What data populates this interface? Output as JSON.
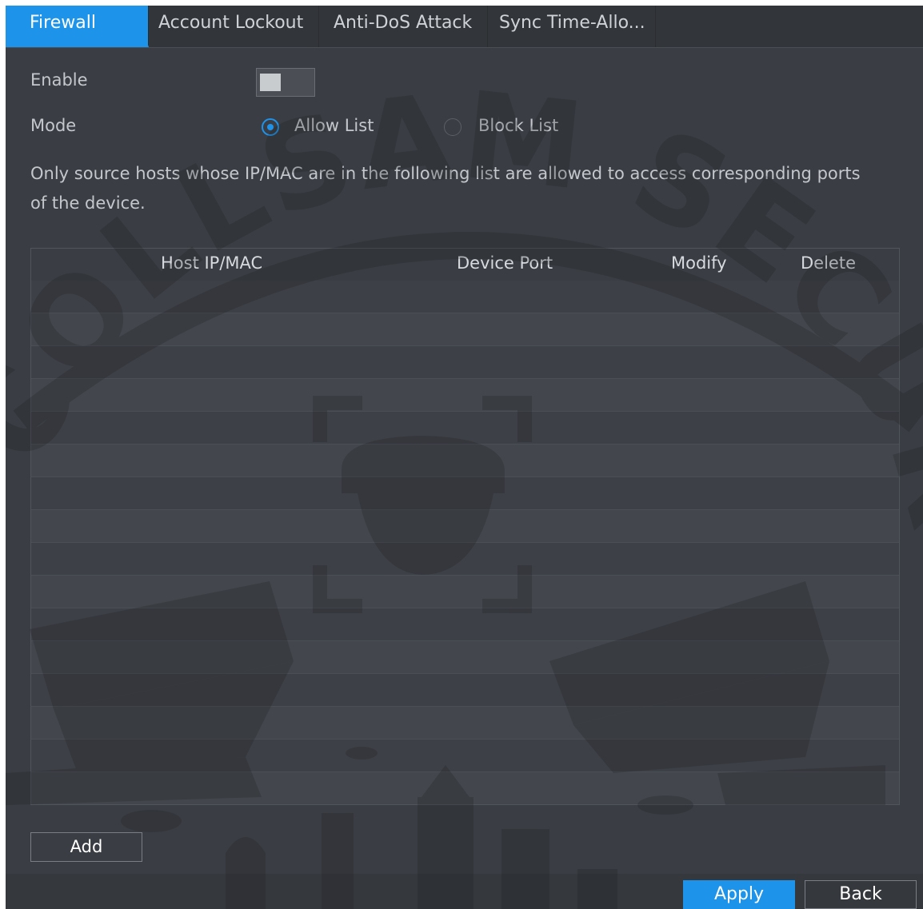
{
  "tabs": [
    {
      "label": "Firewall",
      "active": true
    },
    {
      "label": "Account Lockout",
      "active": false
    },
    {
      "label": "Anti-DoS Attack",
      "active": false
    },
    {
      "label": "Sync Time-Allo...",
      "active": false
    }
  ],
  "form": {
    "enable_label": "Enable",
    "enable_on": false,
    "mode_label": "Mode",
    "mode_options": [
      "Allow List",
      "Block List"
    ],
    "mode_selected": "Allow List",
    "description": "Only source hosts whose IP/MAC are in the following list are allowed to access corresponding ports of the device."
  },
  "table": {
    "columns": [
      "Host IP/MAC",
      "Device Port",
      "Modify",
      "Delete"
    ],
    "rows": []
  },
  "buttons": {
    "add": "Add",
    "apply": "Apply",
    "back": "Back"
  },
  "watermark": {
    "text": "COLLSAM SECURITY"
  },
  "colors": {
    "accent": "#1e93ea",
    "panel_bg": "#3a3d43"
  }
}
